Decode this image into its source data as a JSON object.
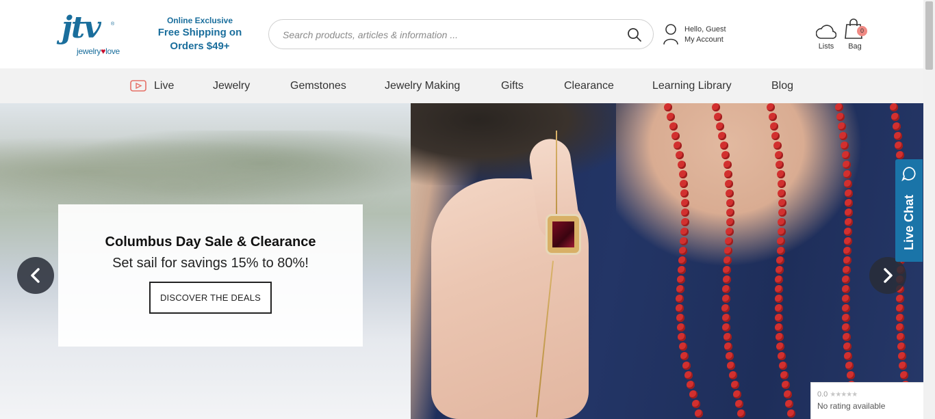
{
  "logo": {
    "main": "jtv",
    "registered": "®",
    "tag_left": "jewelry",
    "tag_heart": "♥",
    "tag_right": "love"
  },
  "promo": {
    "small": "Online Exclusive",
    "line1": "Free Shipping on",
    "line2": "Orders $49+"
  },
  "search": {
    "placeholder": "Search products, articles & information ...",
    "value": ""
  },
  "account": {
    "greeting": "Hello, Guest",
    "label": "My Account"
  },
  "lists": {
    "label": "Lists"
  },
  "bag": {
    "label": "Bag",
    "count": "0"
  },
  "nav": {
    "items": [
      {
        "label": "Live"
      },
      {
        "label": "Jewelry"
      },
      {
        "label": "Gemstones"
      },
      {
        "label": "Jewelry Making"
      },
      {
        "label": "Gifts"
      },
      {
        "label": "Clearance"
      },
      {
        "label": "Learning Library"
      },
      {
        "label": "Blog"
      }
    ]
  },
  "hero": {
    "title": "Columbus Day Sale & Clearance",
    "subtitle": "Set sail for savings 15% to 80%!",
    "button": "DISCOVER THE DEALS"
  },
  "live_chat": {
    "label": "Live Chat"
  },
  "rating": {
    "score": "0.0",
    "stars": "★★★★★",
    "text": "No rating available"
  },
  "colors": {
    "brand": "#1a6e9c",
    "chat": "#1a74a8",
    "nav_bg": "#f2f2f2",
    "bag_badge": "#f08a84"
  }
}
